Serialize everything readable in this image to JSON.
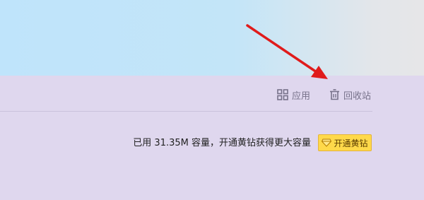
{
  "toolbar": {
    "apps_label": "应用",
    "recycle_label": "回收站"
  },
  "storage": {
    "usage_text": "已用 31.35M 容量，开通黄钻获得更大容量",
    "vip_button_label": "开通黄钻"
  },
  "icons": {
    "apps": "grid-icon",
    "recycle": "trash-icon",
    "vip": "diamond-icon"
  },
  "colors": {
    "banner": "#c3e5f8",
    "panel": "#dfd7ee",
    "vip_button": "#ffd94a",
    "annotation_arrow": "#e01b1b"
  }
}
